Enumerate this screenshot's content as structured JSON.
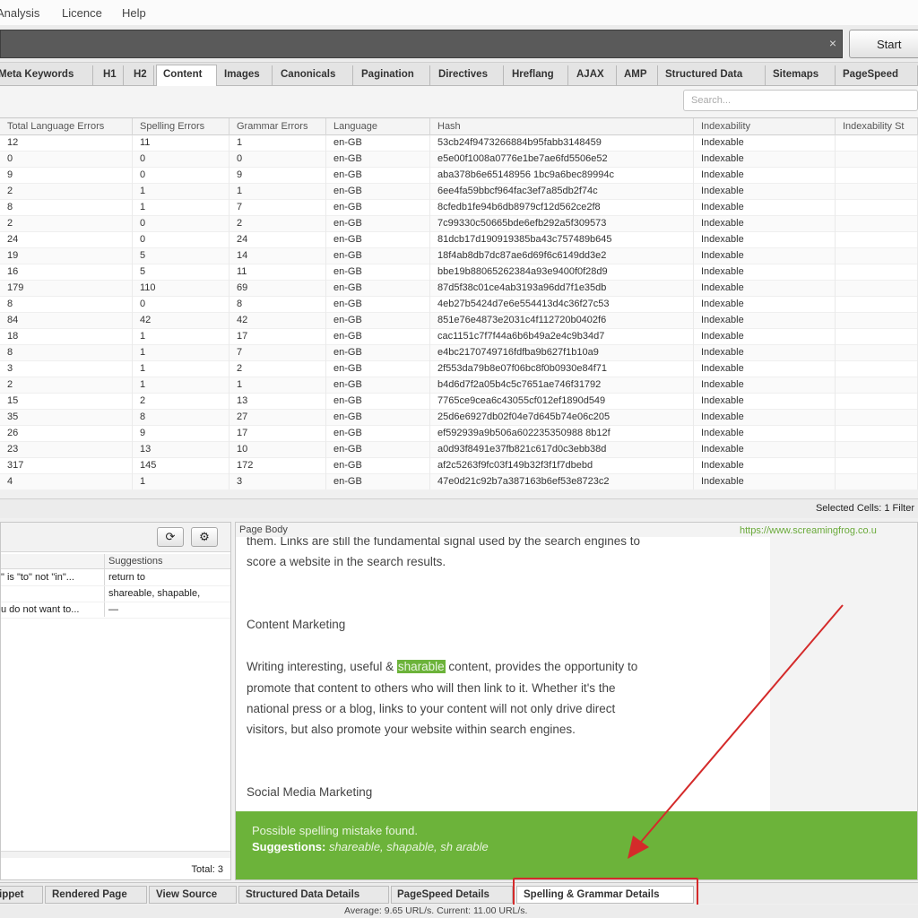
{
  "menu": {
    "items": [
      "Analysis",
      "Licence",
      "Help"
    ]
  },
  "toolbar": {
    "clear_icon": "×",
    "start_label": "Start"
  },
  "tabs": [
    "Meta Keywords",
    "H1",
    "H2",
    "Content",
    "Images",
    "Canonicals",
    "Pagination",
    "Directives",
    "Hreflang",
    "AJAX",
    "AMP",
    "Structured Data",
    "Sitemaps",
    "PageSpeed"
  ],
  "active_tab": "Content",
  "search": {
    "placeholder": "Search..."
  },
  "table": {
    "columns": [
      "Total Language Errors",
      "Spelling Errors",
      "Grammar Errors",
      "Language",
      "Hash",
      "Indexability",
      "Indexability St"
    ],
    "rows": [
      [
        "12",
        "11",
        "1",
        "en-GB",
        "53cb24f9473266884b95fabb3148459",
        "Indexable"
      ],
      [
        "0",
        "0",
        "0",
        "en-GB",
        "e5e00f1008a0776e1be7ae6fd5506e52",
        "Indexable"
      ],
      [
        "9",
        "0",
        "9",
        "en-GB",
        "aba378b6e65148956 1bc9a6bec89994c",
        "Indexable"
      ],
      [
        "2",
        "1",
        "1",
        "en-GB",
        "6ee4fa59bbcf964fac3ef7a85db2f74c",
        "Indexable"
      ],
      [
        "8",
        "1",
        "7",
        "en-GB",
        "8cfedb1fe94b6db8979cf12d562ce2f8",
        "Indexable"
      ],
      [
        "2",
        "0",
        "2",
        "en-GB",
        "7c99330c50665bde6efb292a5f309573",
        "Indexable"
      ],
      [
        "24",
        "0",
        "24",
        "en-GB",
        "81dcb17d190919385ba43c757489b645",
        "Indexable"
      ],
      [
        "19",
        "5",
        "14",
        "en-GB",
        "18f4ab8db7dc87ae6d69f6c6149dd3e2",
        "Indexable"
      ],
      [
        "16",
        "5",
        "11",
        "en-GB",
        "bbe19b88065262384a93e9400f0f28d9",
        "Indexable"
      ],
      [
        "179",
        "110",
        "69",
        "en-GB",
        "87d5f38c01ce4ab3193a96dd7f1e35db",
        "Indexable"
      ],
      [
        "8",
        "0",
        "8",
        "en-GB",
        "4eb27b5424d7e6e554413d4c36f27c53",
        "Indexable"
      ],
      [
        "84",
        "42",
        "42",
        "en-GB",
        "851e76e4873e2031c4f112720b0402f6",
        "Indexable"
      ],
      [
        "18",
        "1",
        "17",
        "en-GB",
        "cac1151c7f7f44a6b6b49a2e4c9b34d7",
        "Indexable"
      ],
      [
        "8",
        "1",
        "7",
        "en-GB",
        "e4bc2170749716fdfba9b627f1b10a9",
        "Indexable"
      ],
      [
        "3",
        "1",
        "2",
        "en-GB",
        "2f553da79b8e07f06bc8f0b0930e84f71",
        "Indexable"
      ],
      [
        "2",
        "1",
        "1",
        "en-GB",
        "b4d6d7f2a05b4c5c7651ae746f31792",
        "Indexable"
      ],
      [
        "15",
        "2",
        "13",
        "en-GB",
        "7765ce9cea6c43055cf012ef1890d549",
        "Indexable"
      ],
      [
        "35",
        "8",
        "27",
        "en-GB",
        "25d6e6927db02f04e7d645b74e06c205",
        "Indexable"
      ],
      [
        "26",
        "9",
        "17",
        "en-GB",
        "ef592939a9b506a602235350988 8b12f",
        "Indexable"
      ],
      [
        "23",
        "13",
        "10",
        "en-GB",
        "a0d93f8491e37fb821c617d0c3ebb38d",
        "Indexable"
      ],
      [
        "317",
        "145",
        "172",
        "en-GB",
        "af2c5263f9fc03f149b32f3f1f7dbebd",
        "Indexable"
      ],
      [
        "4",
        "1",
        "3",
        "en-GB",
        "47e0d21c92b7a387163b6ef53e8723c2",
        "Indexable"
      ]
    ]
  },
  "status": {
    "selected": "Selected Cells:  1   Filter"
  },
  "details": {
    "suggestions_header": "Suggestions",
    "rows": [
      {
        "error": "\" is \"to\" not \"in\"...",
        "suggestion": "return to"
      },
      {
        "error": "",
        "suggestion": "shareable, shapable,"
      },
      {
        "error": "u do not want to...",
        "suggestion": "—"
      }
    ],
    "total": "Total:  3",
    "refresh_icon": "⟳",
    "settings_icon": "⚙"
  },
  "page_body": {
    "label": "Page Body",
    "url": "https://www.screamingfrog.co.u",
    "lines": {
      "l1": "them. Links are still the fundamental signal used by the search engines to",
      "l2": "score a website in the search results.",
      "h1": "Content Marketing",
      "l3_pre": "Writing interesting, useful & ",
      "l3_hl": "sharable",
      "l3_post": " content, provides the opportunity to",
      "l4": "promote that content to others who will then link to it. Whether it's the",
      "l5": "national press or a blog, links to your content will not only drive direct",
      "l6": "visitors, but also promote your website within search engines.",
      "h2": "Social Media Marketing"
    },
    "message": "Possible spelling mistake found.",
    "suggestions_label": "Suggestions:",
    "suggestions_value": " shareable, shapable, sh arable"
  },
  "bottom_tabs": [
    "ippet",
    "Rendered Page",
    "View Source",
    "Structured Data Details",
    "PageSpeed Details",
    "Spelling & Grammar Details"
  ],
  "footer": {
    "text": "Average: 9.65 URL/s. Current: 11.00 URL/s."
  },
  "colors": {
    "highlight_green": "#6cb33a",
    "annotation_red": "#d42a2a"
  }
}
